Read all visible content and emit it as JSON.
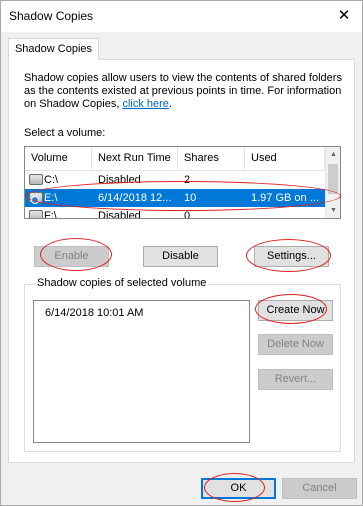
{
  "window": {
    "title": "Shadow Copies",
    "close_glyph": "✕"
  },
  "tabs": [
    {
      "label": "Shadow Copies"
    }
  ],
  "description": {
    "text": "Shadow copies allow users to view the contents of shared folders as the contents existed at previous points in time. For information on Shadow Copies, ",
    "link_text": "click here",
    "suffix": "."
  },
  "volume_select_label": "Select a volume:",
  "volumes": {
    "columns": [
      "Volume",
      "Next Run Time",
      "Shares",
      "Used"
    ],
    "rows": [
      {
        "volume": "C:\\",
        "next_run": "Disabled",
        "shares": "2",
        "used": ""
      },
      {
        "volume": "E:\\",
        "next_run": "6/14/2018 12...",
        "shares": "10",
        "used": "1.97 GB on ...",
        "selected": true
      },
      {
        "volume": "F:\\",
        "next_run": "Disabled",
        "shares": "0",
        "used": ""
      }
    ]
  },
  "buttons": {
    "enable": "Enable",
    "disable": "Disable",
    "settings": "Settings...",
    "create_now": "Create Now",
    "delete_now": "Delete Now",
    "revert": "Revert...",
    "ok": "OK",
    "cancel": "Cancel"
  },
  "copies_group": {
    "title": "Shadow copies of selected volume",
    "items": [
      "6/14/2018 10:01 AM"
    ]
  },
  "colors": {
    "selection": "#0078d7",
    "annotation": "#e02020",
    "link": "#0066cc"
  }
}
